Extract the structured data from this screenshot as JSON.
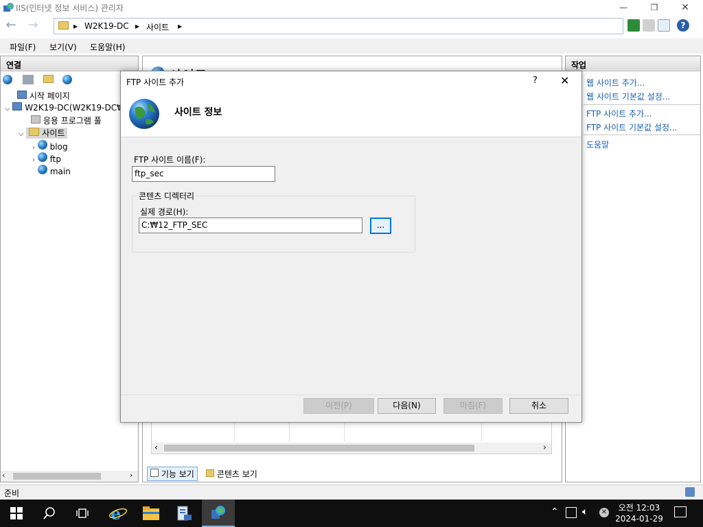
{
  "window": {
    "title": "IIS(인터넷 정보 서비스) 관리자",
    "minimize": "—",
    "restore": "❐",
    "close": "✕"
  },
  "address": {
    "back": "←",
    "forward": "→",
    "crumbs": [
      "W2K19-DC",
      "사이트"
    ],
    "separator": "▸"
  },
  "menu": {
    "file": "파일(F)",
    "view": "보기(V)",
    "help": "도움말(H)"
  },
  "left_panel": {
    "header": "연결",
    "tree": {
      "start_page": "시작 페이지",
      "server": "W2K19-DC(W2K19-DC₩",
      "app_pools": "응용 프로그램 풀",
      "sites": "사이트",
      "site_items": [
        "blog",
        "ftp",
        "main"
      ]
    }
  },
  "center_panel": {
    "title_partial": "사이트",
    "tabs": {
      "features_view": "기능 보기",
      "content_view": "콘텐츠 보기"
    }
  },
  "right_panel": {
    "header": "작업",
    "actions": {
      "add_website": "웹 사이트 추가...",
      "website_defaults": "웹 사이트 기본값 설정...",
      "add_ftp_site": "FTP 사이트 추가...",
      "ftp_site_defaults": "FTP 사이트 기본값 설정...",
      "help": "도움말"
    }
  },
  "status": {
    "text": "준비"
  },
  "dialog": {
    "title": "FTP 사이트 추가",
    "help": "?",
    "close": "✕",
    "header": "사이트 정보",
    "site_name_label": "FTP 사이트 이름(F):",
    "site_name_value": "ftp_sec",
    "content_dir_group": "콘텐츠 디렉터리",
    "physical_path_label": "실제 경로(H):",
    "physical_path_value": "C:₩12_FTP_SEC",
    "browse_label": "...",
    "buttons": {
      "prev": "이전(P)",
      "next": "다음(N)",
      "finish": "마침(F)",
      "cancel": "취소"
    }
  },
  "taskbar": {
    "clock_time": "오전 12:03",
    "clock_date": "2024-01-29"
  },
  "colors": {
    "link": "#1a5fb4",
    "taskbar": "#0f0f0f",
    "accent": "#0078d7"
  }
}
